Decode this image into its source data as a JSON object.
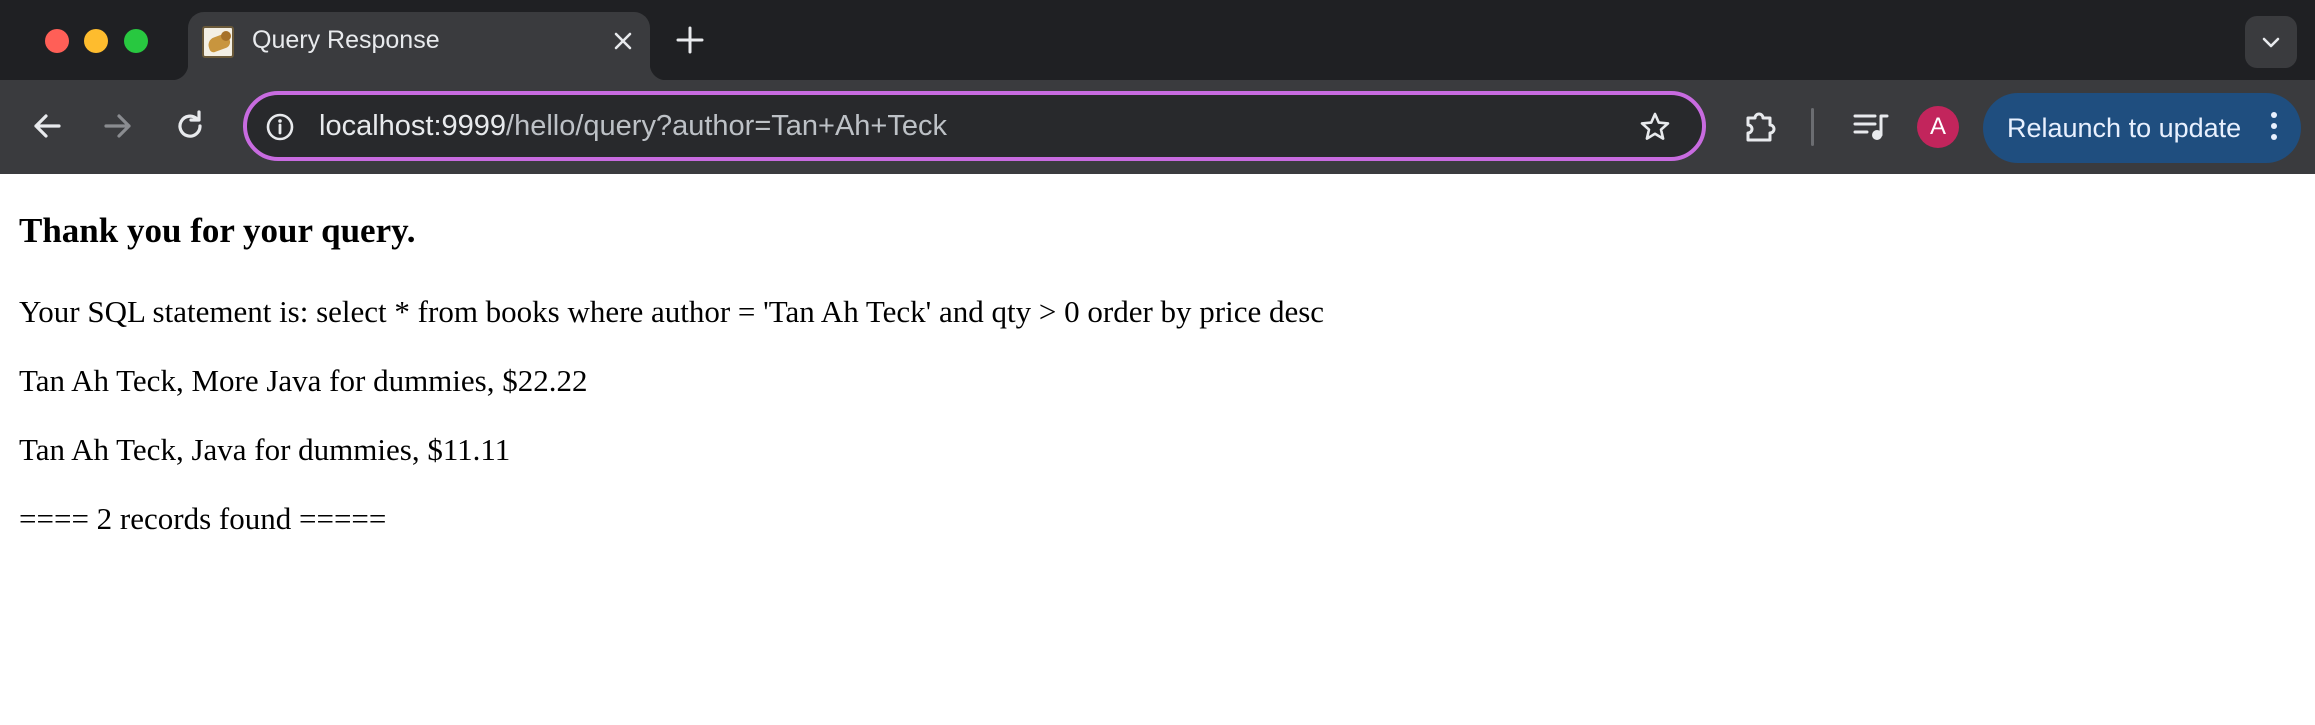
{
  "browser": {
    "tab": {
      "title": "Query Response",
      "favicon": "tomcat-favicon",
      "close_icon": "close-icon"
    },
    "new_tab_icon": "plus-icon",
    "tab_search_icon": "chevron-down-icon",
    "toolbar": {
      "back_icon": "back-arrow-icon",
      "forward_icon": "forward-arrow-icon",
      "reload_icon": "reload-icon",
      "omnibox": {
        "host": "localhost:9999",
        "path": "/hello/query?author=Tan+Ah+Teck",
        "site_info_icon": "info-icon",
        "bookmark_icon": "star-icon",
        "focus_color": "#c86be0"
      },
      "extensions_icon": "puzzle-icon",
      "media_icon": "media-queue-icon",
      "profile_initial": "A",
      "profile_color": "#c2255c",
      "relaunch_label": "Relaunch to update",
      "relaunch_color": "#1f4e7f",
      "menu_icon": "kebab-menu-icon"
    }
  },
  "page": {
    "heading": "Thank you for your query.",
    "sql_statement": "Your SQL statement is: select * from books where author = 'Tan Ah Teck' and qty > 0 order by price desc",
    "records": [
      "Tan Ah Teck, More Java for dummies, $22.22",
      "Tan Ah Teck, Java for dummies, $11.11"
    ],
    "summary": "==== 2 records found ====="
  }
}
